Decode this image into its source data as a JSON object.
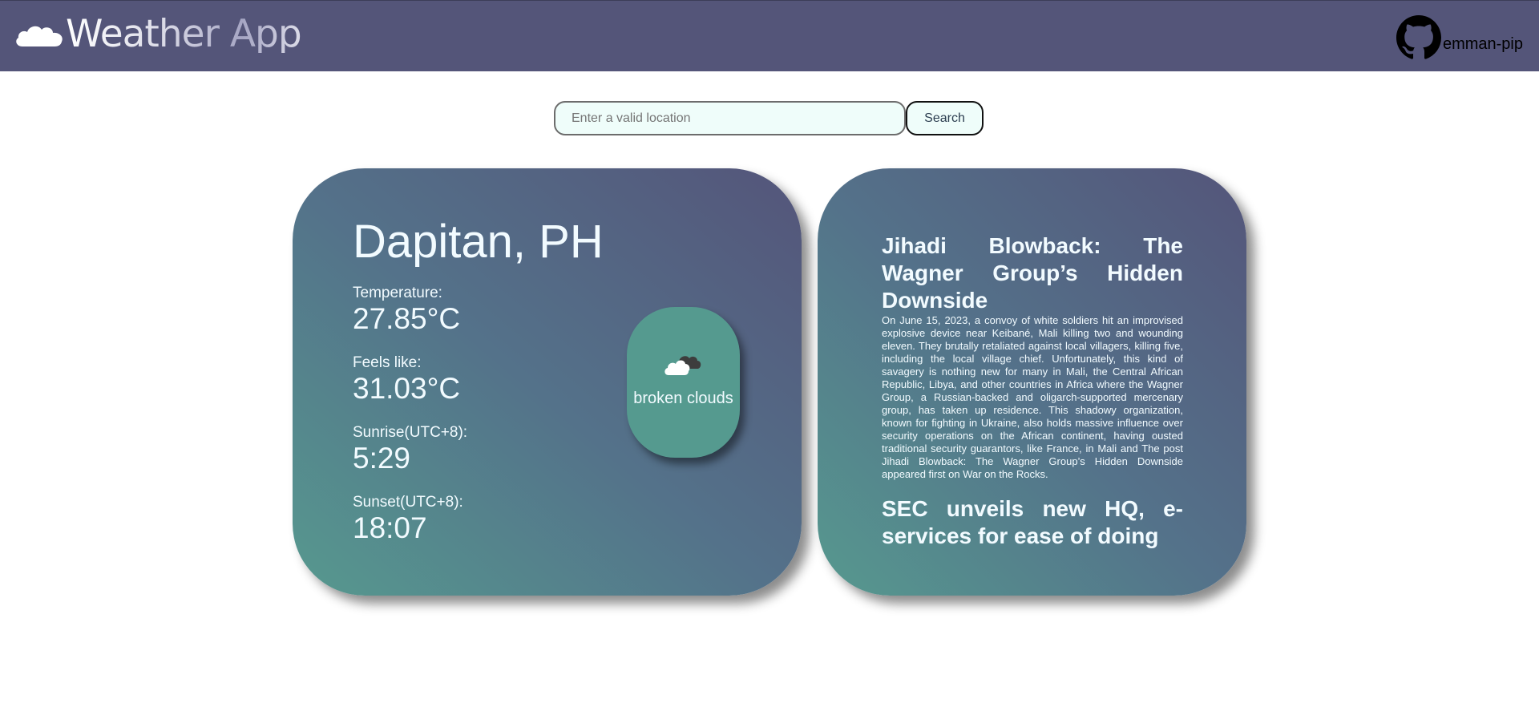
{
  "header": {
    "title": "Weather App",
    "logo_icon": "cloud-icon",
    "github_icon": "github-icon",
    "github_user": "emman-pip"
  },
  "search": {
    "placeholder": "Enter a valid location",
    "button_label": "Search"
  },
  "weather": {
    "city": "Dapitan, PH",
    "temperature_label": "Temperature:",
    "temperature_value": "27.85°C",
    "feels_like_label": "Feels like:",
    "feels_like_value": "31.03°C",
    "sunrise_label": "Sunrise(UTC+8):",
    "sunrise_value": "5:29",
    "sunset_label": "Sunset(UTC+8):",
    "sunset_value": "18:07",
    "condition": "broken clouds",
    "condition_icon": "broken-clouds-icon"
  },
  "news": [
    {
      "title": "Jihadi Blowback: The Wagner Group’s Hidden Downside",
      "body": "On June 15, 2023, a convoy of white soldiers hit an improvised explosive device near Keibané, Mali killing two and wounding eleven. They brutally retaliated against local villagers, killing five, including the local village chief. Unfortunately, this kind of savagery is nothing new for many in Mali, the Central African Republic, Libya, and other countries in Africa where the Wagner Group, a Russian-backed and oligarch-supported mercenary group, has taken up residence. This shadowy organization, known for fighting in Ukraine, also holds massive influence over security operations on the African continent, having ousted traditional security guarantors, like France, in Mali and The post Jihadi Blowback: The Wagner Group’s Hidden Downside appeared first on War on the Rocks."
    },
    {
      "title": "SEC unveils new HQ, e-services for ease of doing",
      "body": ""
    }
  ],
  "colors": {
    "header_bg": "#545579",
    "card_gradient_start": "#56998f",
    "card_gradient_end": "#54557a",
    "input_bg": "#effdfa"
  }
}
